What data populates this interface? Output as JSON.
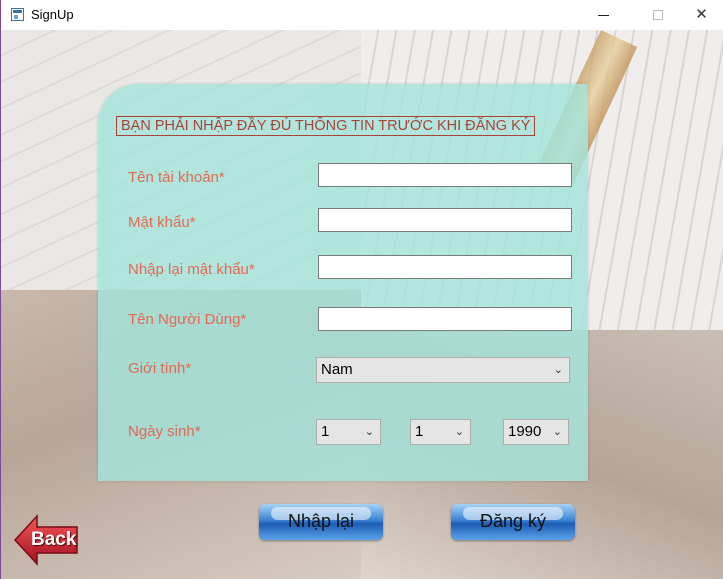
{
  "window": {
    "title": "SignUp"
  },
  "form": {
    "header": "BẠN PHẢI NHẬP ĐẦY ĐỦ THÔNG TIN TRƯỚC KHI ĐĂNG KÝ",
    "fields": {
      "username_label": "Tên tài khoản*",
      "username_value": "",
      "password_label": "Mật khẩu*",
      "password_value": "",
      "confirm_label": "Nhập lại mật khẩu*",
      "confirm_value": "",
      "fullname_label": "Tên Người Dùng*",
      "fullname_value": "",
      "gender_label": "Giới tính*",
      "gender_value": "Nam",
      "birthday_label": "Ngày sinh*",
      "day_value": "1",
      "month_value": "1",
      "year_value": "1990"
    }
  },
  "buttons": {
    "reset": "Nhập lại",
    "register": "Đăng ký",
    "back": "Back"
  },
  "colors": {
    "label": "#e36b51",
    "header": "#a94438",
    "panel": "#a4e4dc",
    "button": "#3c84d6",
    "back": "#c8102e"
  }
}
